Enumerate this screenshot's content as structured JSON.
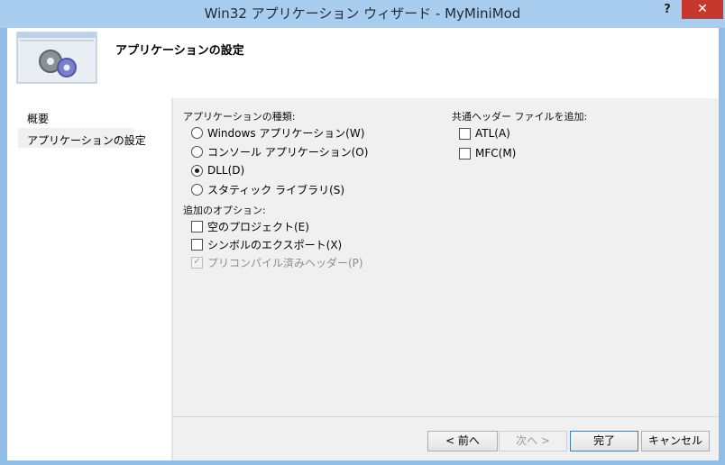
{
  "window": {
    "title": "Win32 アプリケーション ウィザード - MyMiniMod",
    "help_label": "?",
    "close_label": "✕"
  },
  "header": {
    "title": "アプリケーションの設定",
    "logo_icon": "wizard-gears-icon"
  },
  "sidebar": {
    "items": [
      {
        "label": "概要"
      },
      {
        "label": "アプリケーションの設定",
        "selected": true
      }
    ]
  },
  "app_type": {
    "label": "アプリケーションの種類:",
    "options": [
      {
        "label": "Windows アプリケーション(W)",
        "selected": false
      },
      {
        "label": "コンソール アプリケーション(O)",
        "selected": false
      },
      {
        "label": "DLL(D)",
        "selected": true
      },
      {
        "label": "スタティック ライブラリ(S)",
        "selected": false
      }
    ]
  },
  "extra_options": {
    "label": "追加のオプション:",
    "options": [
      {
        "label": "空のプロジェクト(E)",
        "checked": false,
        "enabled": true
      },
      {
        "label": "シンボルのエクスポート(X)",
        "checked": false,
        "enabled": true
      },
      {
        "label": "プリコンパイル済みヘッダー(P)",
        "checked": true,
        "enabled": false
      }
    ]
  },
  "common_headers": {
    "label": "共通ヘッダー ファイルを追加:",
    "options": [
      {
        "label": "ATL(A)",
        "checked": false
      },
      {
        "label": "MFC(M)",
        "checked": false
      }
    ]
  },
  "buttons": {
    "back": "< 前へ",
    "next": "次へ >",
    "finish": "完了",
    "cancel": "キャンセル"
  },
  "colors": {
    "frame": "#8fbde6",
    "close_button": "#c7382c"
  }
}
